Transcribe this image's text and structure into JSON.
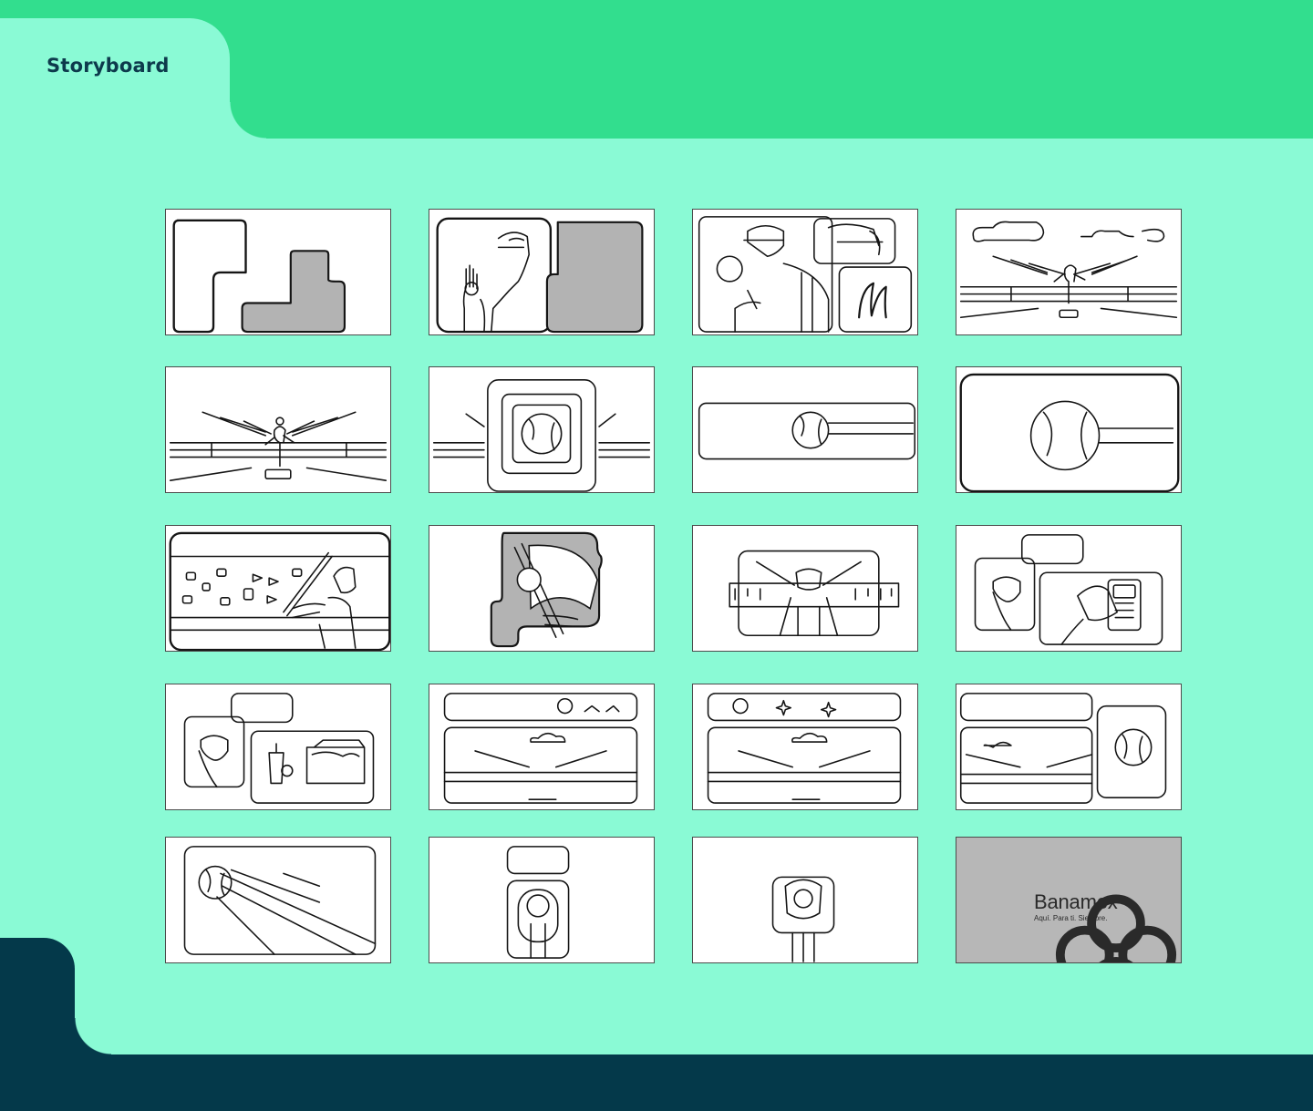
{
  "header": {
    "title": "Storyboard"
  },
  "brand": {
    "name": "Banamex",
    "tagline": "Aquí. Para ti. Siempre."
  },
  "colors": {
    "background": "#8afad5",
    "top_band": "#32de8e",
    "bottom_band": "#04394a",
    "title": "#0d3a4c",
    "placeholder_fill": "#b3b3b3"
  },
  "frames": [
    {
      "id": 1,
      "icon": "layout-blocks-sketch"
    },
    {
      "id": 2,
      "icon": "pitcher-hand-sketch"
    },
    {
      "id": 3,
      "icon": "pitcher-glove-sketch"
    },
    {
      "id": 4,
      "icon": "stadium-pitcher-wide-sketch"
    },
    {
      "id": 5,
      "icon": "stadium-pitcher-sketch"
    },
    {
      "id": 6,
      "icon": "stadium-ball-zoom-sketch"
    },
    {
      "id": 7,
      "icon": "ball-flying-sketch"
    },
    {
      "id": 8,
      "icon": "ball-closeup-sketch"
    },
    {
      "id": 9,
      "icon": "batter-sketch"
    },
    {
      "id": 10,
      "icon": "bat-ball-contact-sketch"
    },
    {
      "id": 11,
      "icon": "fan-stands-sketch"
    },
    {
      "id": 12,
      "icon": "fan-payment-terminal-sketch"
    },
    {
      "id": 13,
      "icon": "fan-snacks-sketch"
    },
    {
      "id": 14,
      "icon": "stadium-split-sky-sketch"
    },
    {
      "id": 15,
      "icon": "stadium-split-stars-sketch"
    },
    {
      "id": 16,
      "icon": "stadium-ball-inset-sketch"
    },
    {
      "id": 17,
      "icon": "ball-trail-sketch"
    },
    {
      "id": 18,
      "icon": "ball-glove-sketch"
    },
    {
      "id": 19,
      "icon": "glove-catch-sketch"
    },
    {
      "id": 20,
      "icon": "banamex-logo"
    }
  ]
}
